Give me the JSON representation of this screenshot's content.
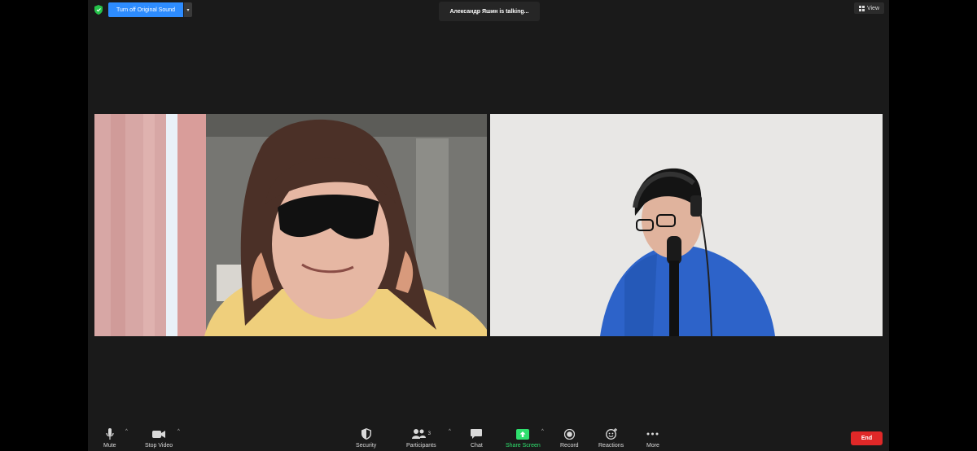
{
  "topbar": {
    "original_sound_label": "Turn off Original Sound",
    "caret": "▾",
    "talking_indicator": "Александр Яшин is talking...",
    "view_label": "View"
  },
  "toolbar": {
    "mute_label": "Mute",
    "stop_video_label": "Stop Video",
    "security_label": "Security",
    "participants_label": "Participants",
    "participants_count": "3",
    "chat_label": "Chat",
    "share_screen_label": "Share Screen",
    "record_label": "Record",
    "reactions_label": "Reactions",
    "more_label": "More",
    "end_label": "End",
    "caret": "^"
  },
  "colors": {
    "accent": "#2d8cff",
    "end": "#e02828",
    "share": "#2fe06e",
    "background": "#1a1a1a"
  }
}
